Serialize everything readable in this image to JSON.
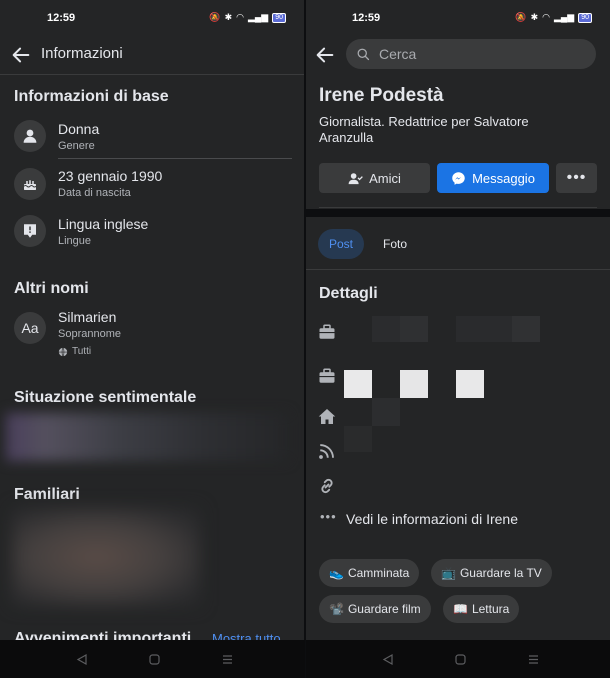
{
  "status_bar": {
    "time": "12:59",
    "battery": "90"
  },
  "left": {
    "header_title": "Informazioni",
    "basic": {
      "heading": "Informazioni di base",
      "items": [
        {
          "value": "Donna",
          "label": "Genere"
        },
        {
          "value": "23 gennaio 1990",
          "label": "Data di nascita"
        },
        {
          "value": "Lingua inglese",
          "label": "Lingue"
        }
      ]
    },
    "other_names": {
      "heading": "Altri nomi",
      "name": "Silmarien",
      "label": "Soprannome",
      "visibility": "Tutti",
      "icon_text": "Aa"
    },
    "relationship_heading": "Situazione sentimentale",
    "family_heading": "Familiari",
    "events_heading": "Avvenimenti importanti",
    "show_all": "Mostra tutto"
  },
  "right": {
    "search_placeholder": "Cerca",
    "profile_name": "Irene Podestà",
    "bio": "Giornalista. Redattrice per Salvatore Aranzulla",
    "buttons": {
      "friends": "Amici",
      "message": "Messaggio"
    },
    "tabs": {
      "posts": "Post",
      "photos": "Foto"
    },
    "details_heading": "Dettagli",
    "see_info": "Vedi le informazioni di Irene",
    "hobbies": [
      {
        "emoji": "👟",
        "label": "Camminata"
      },
      {
        "emoji": "📺",
        "label": "Guardare la TV"
      },
      {
        "emoji": "📽️",
        "label": "Guardare film"
      },
      {
        "emoji": "📖",
        "label": "Lettura"
      }
    ]
  },
  "colors": {
    "accent": "#1b74e4",
    "panel_bg": "#242526",
    "chip_bg": "#3a3b3c"
  }
}
